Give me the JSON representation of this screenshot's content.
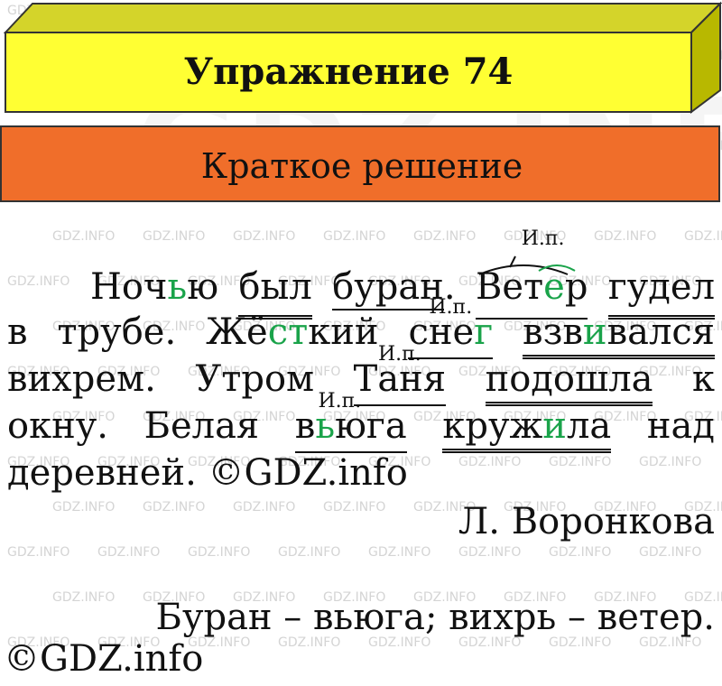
{
  "header": {
    "title": "Упражнение 74",
    "subtitle": "Краткое решение",
    "colors": {
      "title_bg": "#ffff33",
      "subtitle_bg": "#f06e2a",
      "accent": "#1aa34a"
    }
  },
  "watermark": "GDZ.INFO",
  "text": {
    "l1": {
      "w1a": "Ноч",
      "w1b": "ь",
      "w1c": "ю",
      "w2": "был",
      "w3": "буран",
      "p1": ".",
      "w4a": "Вет",
      "w4b": "е",
      "w4c": "р",
      "w5": "гудел"
    },
    "l2": {
      "w1": "в",
      "w2": "трубе.",
      "w3a": "Жё",
      "w3b": "с",
      "w3c": "т",
      "w3d": "кий",
      "w4a": "сне",
      "w4b": "г",
      "w5a": "взв",
      "w5b": "и",
      "w5c": "вался"
    },
    "l3": {
      "w1": "вихрем.",
      "w2": "Утром",
      "w3": "Таня",
      "w4": "подошла",
      "w5": "к"
    },
    "l4": {
      "w1": "окну.",
      "w2": "Белая",
      "w3a": "в",
      "w3b": "ь",
      "w3c": "юга",
      "w4a": "круж",
      "w4b": "и",
      "w4c": "ла",
      "w5": "над"
    },
    "l5": {
      "w1": "деревней. ©GDZ.info"
    },
    "case_label": "И.п."
  },
  "author": "Л. Воронкова",
  "answer": {
    "l1": "Буран – вьюга; вихрь – ветер.",
    "l2": "©GDZ.info"
  }
}
